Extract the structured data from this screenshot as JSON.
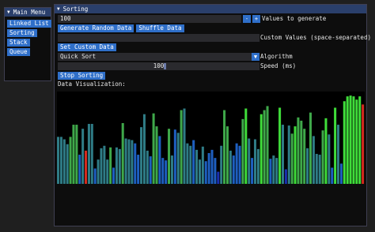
{
  "menu": {
    "title": "Main Menu",
    "items": [
      "Linked List",
      "Sorting",
      "Stack",
      "Queue"
    ]
  },
  "sorting": {
    "title": "Sorting",
    "values_input": "100",
    "minus": "-",
    "plus": "+",
    "values_label": "Values to generate",
    "generate_label": "Generate Random Data",
    "shuffle_label": "Shuffle Data",
    "custom_values_value": "",
    "custom_values_label": "Custom Values (space-separated)",
    "set_custom_label": "Set Custom Data",
    "algorithm_value": "Quick Sort",
    "algorithm_label": "Algorithm",
    "speed_value": "100",
    "speed_fraction": 0.53,
    "speed_label": "Speed (ms)",
    "stop_label": "Stop Sorting",
    "viz_label": "Data Visualization:"
  },
  "colors": {
    "bright_green": "#3fdc3a",
    "green": "#3fa84a",
    "teal": "#2f7c86",
    "blue": "#1e5fc0",
    "dark_blue": "#1a2fb0",
    "red": "#d42a1e"
  },
  "chart_data": {
    "type": "bar",
    "values": [
      58,
      58,
      55,
      49,
      58,
      73,
      73,
      36,
      68,
      41,
      74,
      74,
      19,
      30,
      44,
      47,
      30,
      45,
      20,
      45,
      43,
      75,
      56,
      55,
      54,
      50,
      36,
      70,
      86,
      41,
      34,
      87,
      71,
      59,
      32,
      29,
      68,
      35,
      67,
      63,
      91,
      93,
      50,
      47,
      54,
      42,
      30,
      46,
      28,
      38,
      42,
      32,
      15,
      47,
      91,
      71,
      41,
      35,
      50,
      47,
      80,
      93,
      56,
      32,
      55,
      43,
      86,
      91,
      96,
      31,
      35,
      32,
      94,
      73,
      18,
      72,
      62,
      71,
      82,
      78,
      68,
      44,
      88,
      59,
      37,
      36,
      66,
      81,
      61,
      20,
      94,
      73,
      25,
      102,
      108,
      109,
      108,
      104,
      108,
      98
    ],
    "colors": [
      "t",
      "t",
      "t",
      "t",
      "g",
      "g",
      "g",
      "b",
      "t",
      "r",
      "t",
      "t",
      "b",
      "t",
      "t",
      "t",
      "t",
      "g",
      "b",
      "t",
      "t",
      "g",
      "t",
      "t",
      "t",
      "b",
      "b",
      "t",
      "t",
      "t",
      "b",
      "g",
      "g",
      "b",
      "b",
      "b",
      "g",
      "t",
      "b",
      "t",
      "g",
      "t",
      "t",
      "t",
      "b",
      "t",
      "t",
      "t",
      "b",
      "b",
      "b",
      "b",
      "d",
      "t",
      "g",
      "g",
      "t",
      "b",
      "b",
      "b",
      "g",
      "G",
      "t",
      "b",
      "t",
      "t",
      "G",
      "g",
      "g",
      "b",
      "t",
      "t",
      "G",
      "t",
      "d",
      "t",
      "g",
      "G",
      "g",
      "g",
      "g",
      "t",
      "g",
      "t",
      "t",
      "t",
      "g",
      "G",
      "t",
      "b",
      "G",
      "t",
      "b",
      "G",
      "G",
      "G",
      "G",
      "G",
      "G",
      "r"
    ],
    "ylim": [
      0,
      112
    ]
  }
}
